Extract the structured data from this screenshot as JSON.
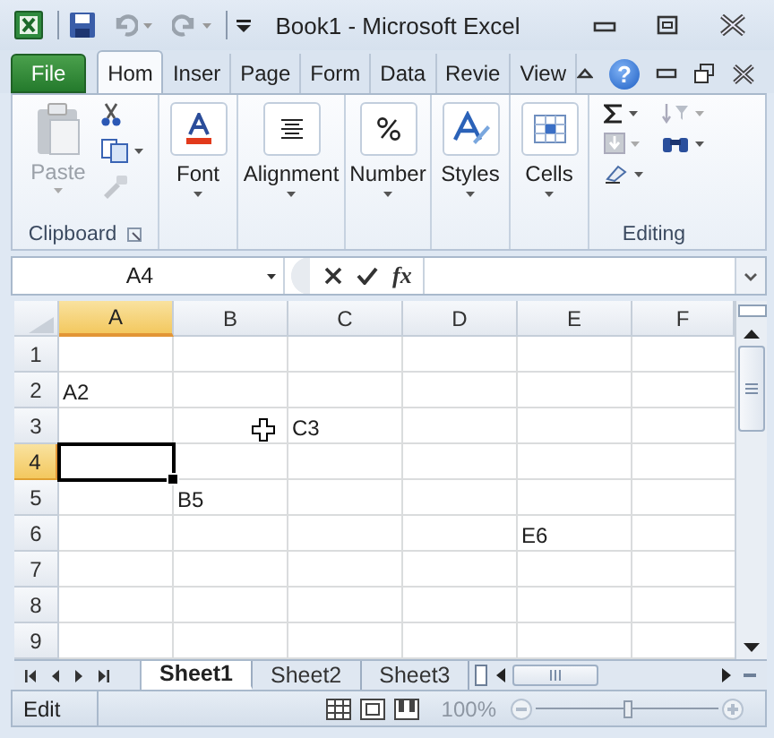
{
  "title_bar": {
    "title": "Book1  -  Microsoft Excel"
  },
  "ribbon_tabs": [
    {
      "label": "File",
      "kind": "file",
      "selected": false
    },
    {
      "label": "Hom",
      "kind": "tab",
      "selected": true
    },
    {
      "label": "Inser",
      "kind": "tab",
      "selected": false
    },
    {
      "label": "Page",
      "kind": "tab",
      "selected": false
    },
    {
      "label": "Form",
      "kind": "tab",
      "selected": false
    },
    {
      "label": "Data",
      "kind": "tab",
      "selected": false
    },
    {
      "label": "Revie",
      "kind": "tab",
      "selected": false
    },
    {
      "label": "View",
      "kind": "tab",
      "selected": false
    }
  ],
  "help_glyph": "?",
  "ribbon_groups": [
    {
      "kind": "clipboard",
      "caption": "Clipboard",
      "paste": {
        "label": "Paste",
        "disabled": true
      }
    },
    {
      "kind": "font",
      "label": "Font"
    },
    {
      "kind": "alignment",
      "label": "Alignment"
    },
    {
      "kind": "number",
      "label": "Number"
    },
    {
      "kind": "styles",
      "label": "Styles"
    },
    {
      "kind": "cells",
      "label": "Cells"
    },
    {
      "kind": "editing",
      "caption": "Editing"
    }
  ],
  "formula_bar": {
    "name_box": "A4",
    "function_label": "fx"
  },
  "columns": [
    {
      "label": "A",
      "selected": true
    },
    {
      "label": "B",
      "selected": false
    },
    {
      "label": "C",
      "selected": false
    },
    {
      "label": "D",
      "selected": false
    },
    {
      "label": "E",
      "selected": false
    },
    {
      "label": "F",
      "selected": false
    }
  ],
  "rows": [
    {
      "label": "1",
      "selected": false
    },
    {
      "label": "2",
      "selected": false,
      "cells": {
        "A": "A2"
      }
    },
    {
      "label": "3",
      "selected": false,
      "cells": {
        "C": "C3"
      }
    },
    {
      "label": "4",
      "selected": true
    },
    {
      "label": "5",
      "selected": false,
      "cells": {
        "B": "B5"
      }
    },
    {
      "label": "6",
      "selected": false,
      "cells": {
        "E": "E6"
      }
    },
    {
      "label": "7",
      "selected": false
    },
    {
      "label": "8",
      "selected": false
    },
    {
      "label": "9",
      "selected": false
    }
  ],
  "sheet_tabs": [
    {
      "label": "Sheet1",
      "selected": true
    },
    {
      "label": "Sheet2",
      "selected": false
    },
    {
      "label": "Sheet3",
      "selected": false
    }
  ],
  "status_bar": {
    "mode": "Edit",
    "zoom": "100%",
    "zoom_slider": {
      "level": 0.5
    }
  }
}
